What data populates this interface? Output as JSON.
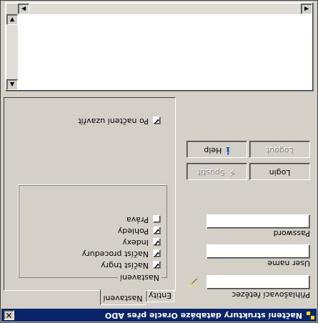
{
  "window": {
    "title": "Načtení struktury databáze Oracle přes ADO",
    "close_glyph": "✕"
  },
  "tabs": [
    {
      "label": "Entity",
      "selected": false
    },
    {
      "label": "Nastavení",
      "selected": true
    }
  ],
  "settings": {
    "group_title": "Nastavení",
    "options": [
      {
        "label": "Načíst tngry",
        "checked": true
      },
      {
        "label": "Načíst procedury",
        "checked": true
      },
      {
        "label": "Indexy",
        "checked": true
      },
      {
        "label": "Pohledy",
        "checked": true
      },
      {
        "label": "Práva",
        "checked": false
      }
    ],
    "close_after_load": {
      "label": "Po načtení uzavřít",
      "checked": true
    },
    "check_glyph": "✔"
  },
  "login": {
    "connection_label": "Přihlašovací řetězec",
    "connection_value": "",
    "user_label": "User name",
    "user_value": "",
    "password_label": "Password",
    "password_value": "",
    "connection_icon": "wizard-icon"
  },
  "buttons": {
    "login": "Login",
    "run": "Spustit",
    "logout": "Logout",
    "help": "Help",
    "help_icon": "info-icon",
    "run_icon": "lightning-icon"
  },
  "memo": {
    "content": ""
  }
}
